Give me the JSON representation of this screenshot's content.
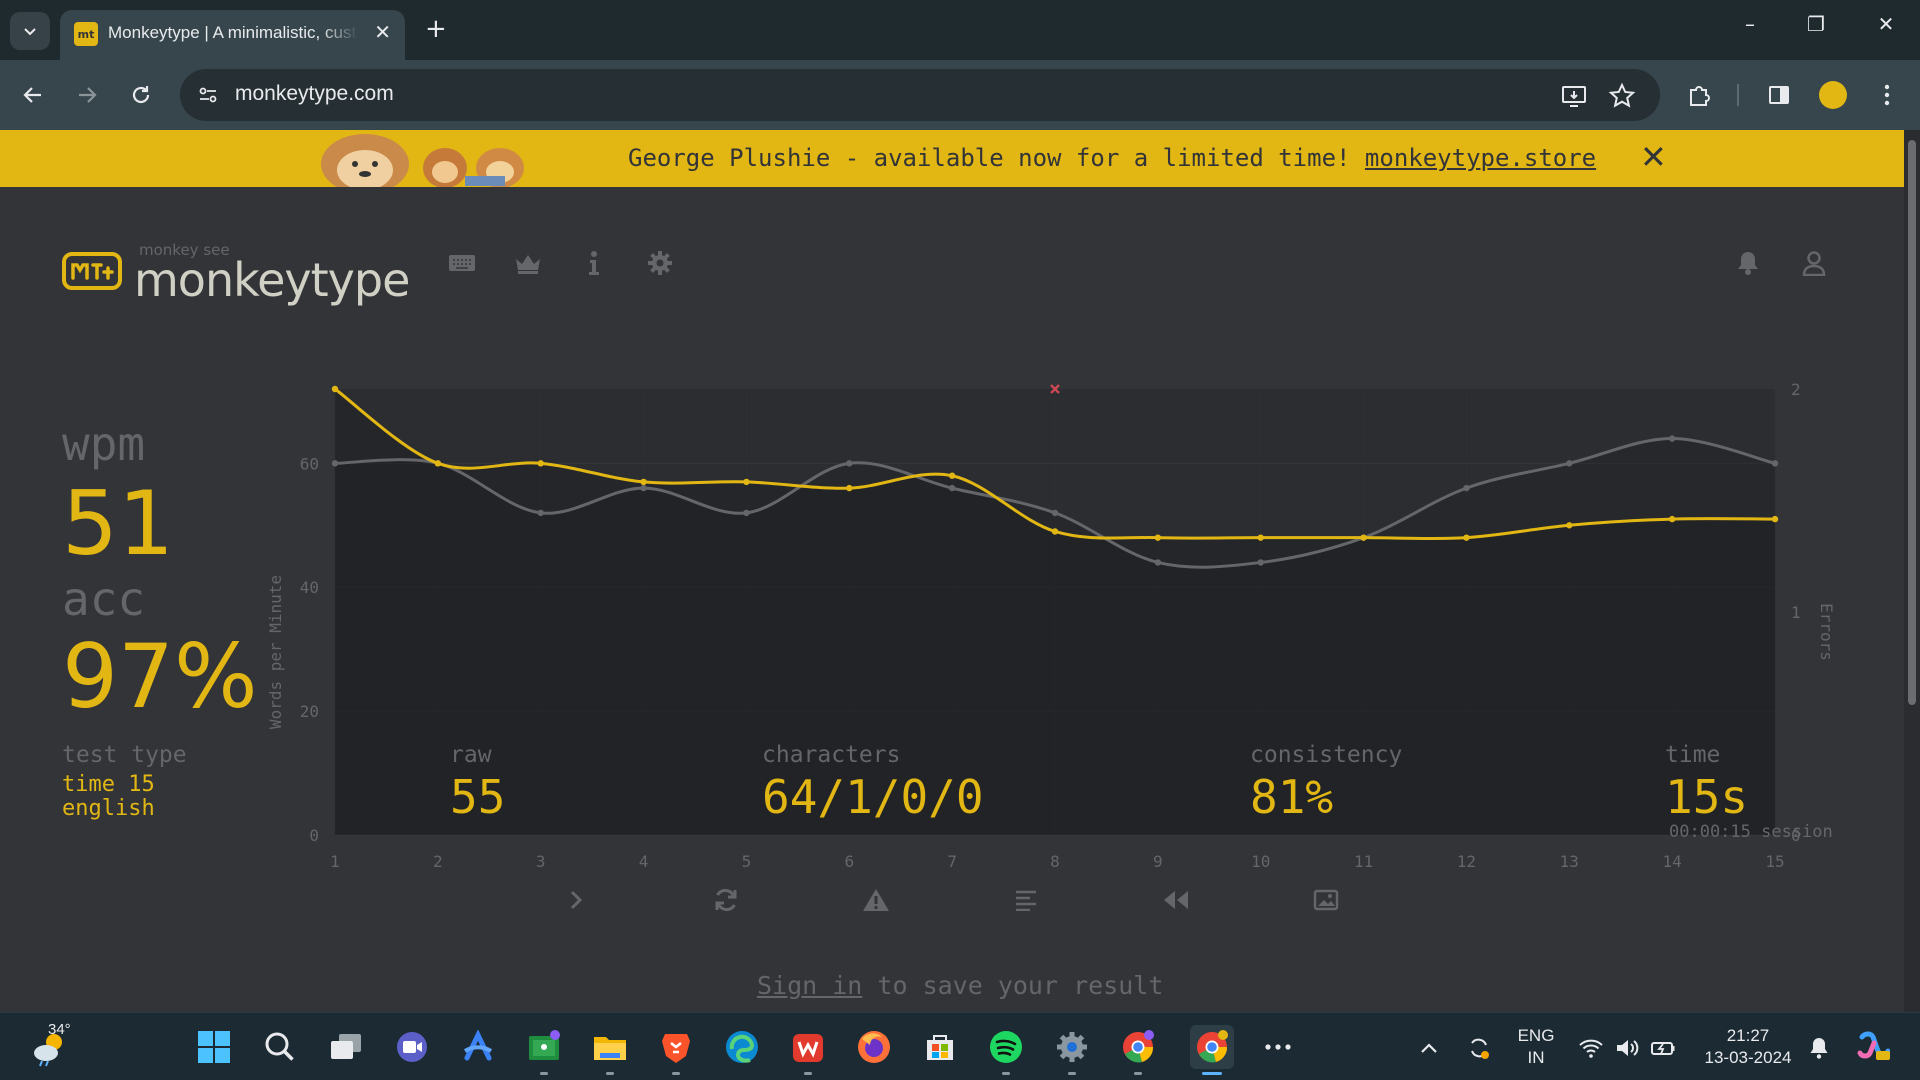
{
  "browser": {
    "tab_title": "Monkeytype | A minimalistic, customizable typing test",
    "tab_favicon_text": "mt",
    "url": "monkeytype.com"
  },
  "banner": {
    "text": "George Plushie - available now for a limited time! ",
    "link": "monkeytype.store",
    "close": "✕"
  },
  "header": {
    "logo_small": "monkey see",
    "logo_text": "monkeytype"
  },
  "result": {
    "wpm_label": "wpm",
    "wpm": "51",
    "acc_label": "acc",
    "acc": "97%",
    "test_type_label": "test type",
    "test_type_line1": "time 15",
    "test_type_line2": "english",
    "raw_label": "raw",
    "raw": "55",
    "characters_label": "characters",
    "characters": "64/1/0/0",
    "consistency_label": "consistency",
    "consistency": "81%",
    "time_label": "time",
    "time": "15s",
    "session": "00:00:15 session"
  },
  "chart_data": {
    "type": "line",
    "x": [
      1,
      2,
      3,
      4,
      5,
      6,
      7,
      8,
      9,
      10,
      11,
      12,
      13,
      14,
      15
    ],
    "ylabel": "Words per Minute",
    "y2label": "Errors",
    "ylim": [
      0,
      72
    ],
    "y2lim": [
      0,
      2
    ],
    "yticks": [
      0,
      20,
      40,
      60
    ],
    "y2ticks": [
      0,
      1,
      2
    ],
    "grid": true,
    "series": [
      {
        "role": "wpm",
        "color": "#e2b714",
        "values": [
          72,
          60,
          60,
          57,
          57,
          56,
          58,
          49,
          48,
          48,
          48,
          48,
          50,
          51,
          51
        ]
      },
      {
        "role": "raw",
        "color": "#646669",
        "values": [
          60,
          60,
          52,
          56,
          52,
          60,
          56,
          52,
          44,
          44,
          48,
          56,
          60,
          64,
          60
        ]
      },
      {
        "role": "errors",
        "color": "#ca4754",
        "points": [
          {
            "x": 8,
            "y": 2
          }
        ]
      }
    ]
  },
  "footer": {
    "signin_link": "Sign in",
    "signin_rest": " to save your result"
  },
  "taskbar": {
    "temperature": "34°",
    "lang_top": "ENG",
    "lang_bottom": "IN",
    "time": "21:27",
    "date": "13-03-2024"
  }
}
